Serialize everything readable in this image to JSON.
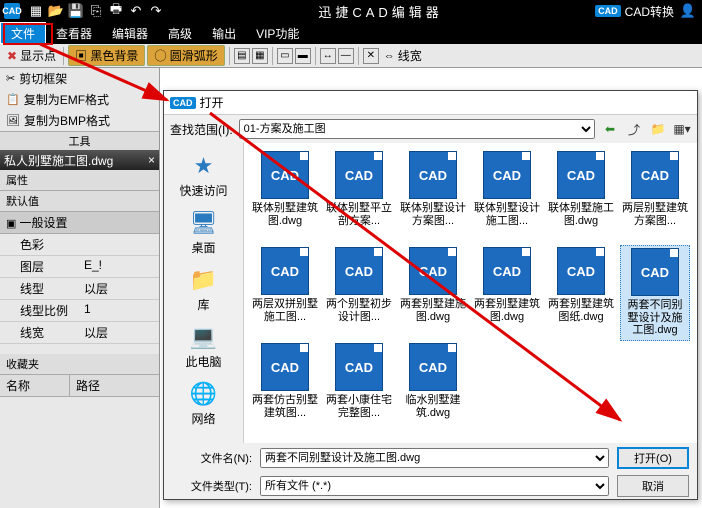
{
  "titlebar": {
    "app_name": "迅捷CAD编辑器",
    "cad_convert": "CAD转换"
  },
  "menu": {
    "file": "文件",
    "viewer": "查看器",
    "editor": "编辑器",
    "advanced": "高级",
    "output": "输出",
    "vip": "VIP功能"
  },
  "ribbon": {
    "show_point": "显示点",
    "black_bg": "黑色背景",
    "arc": "圆滑弧形",
    "linewidth": "线宽"
  },
  "leftpane": {
    "cut_frame": "剪切框架",
    "copy_emf": "复制为EMF格式",
    "copy_bmp": "复制为BMP格式",
    "tool_hdr": "工具",
    "tab": "私人别墅施工图.dwg",
    "props": "属性",
    "default": "默认值",
    "general": "一般设置",
    "rows": [
      {
        "k": "色彩",
        "v": ""
      },
      {
        "k": "图层",
        "v": "E_!"
      },
      {
        "k": "线型",
        "v": "以层"
      },
      {
        "k": "线型比例",
        "v": "1"
      },
      {
        "k": "线宽",
        "v": "以层"
      }
    ],
    "fav": "收藏夹",
    "name": "名称",
    "path": "路径"
  },
  "dialog": {
    "title": "打开",
    "scope_label": "查找范围(I):",
    "scope_value": "01-方案及施工图",
    "places": {
      "quick": "快速访问",
      "desktop": "桌面",
      "lib": "库",
      "pc": "此电脑",
      "net": "网络"
    },
    "files": [
      "联体别墅建筑图.dwg",
      "联体别墅平立剖方案...",
      "联体别墅设计方案图...",
      "联体别墅设计施工图...",
      "联体别墅施工图.dwg",
      "两层别墅建筑方案图...",
      "两层双拼别墅施工图...",
      "两个别墅初步设计图...",
      "两套别墅建施图.dwg",
      "两套别墅建筑图.dwg",
      "两套别墅建筑图纸.dwg",
      "两套不同别墅设计及施工图.dwg",
      "两套仿古别墅建筑图...",
      "两套小康住宅完整图...",
      "临水别墅建筑.dwg"
    ],
    "selected_index": 11,
    "filename_label": "文件名(N):",
    "filename_value": "两套不同别墅设计及施工图.dwg",
    "filetype_label": "文件类型(T):",
    "filetype_value": "所有文件 (*.*)",
    "open_btn": "打开(O)",
    "cancel_btn": "取消"
  }
}
